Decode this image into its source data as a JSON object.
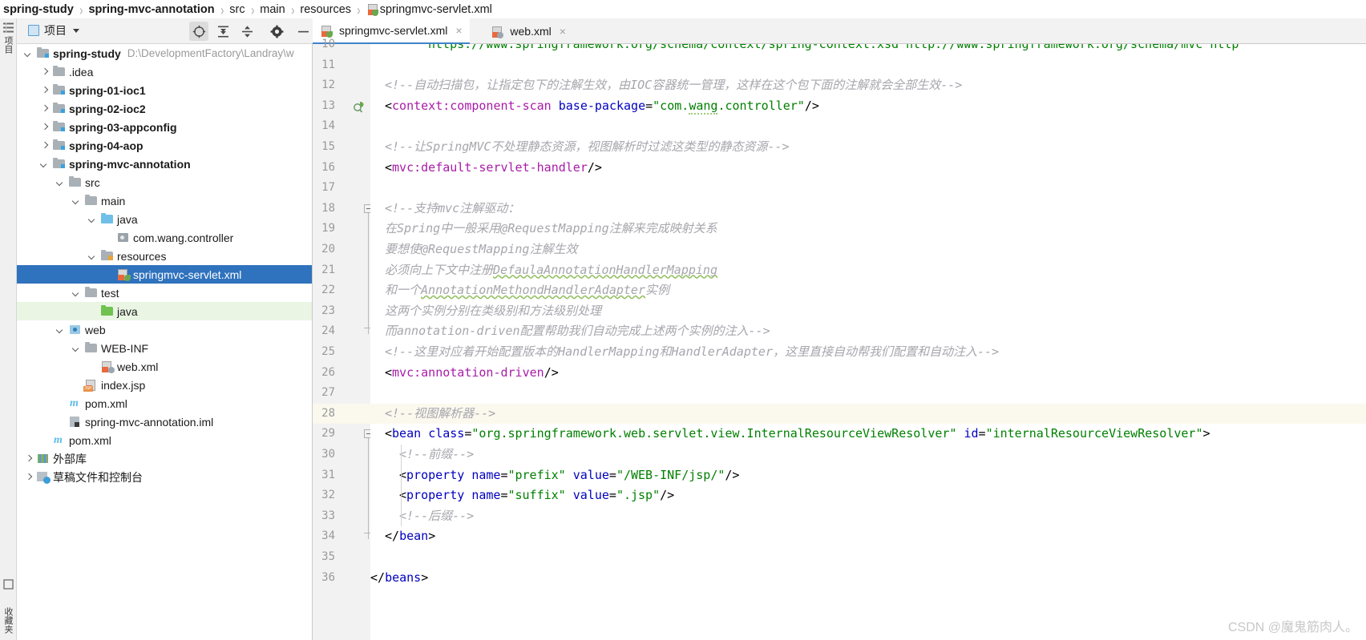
{
  "breadcrumb": {
    "items": [
      {
        "label": "spring-study",
        "bold": true,
        "icon": ""
      },
      {
        "label": "spring-mvc-annotation",
        "bold": true,
        "icon": ""
      },
      {
        "label": "src",
        "bold": false,
        "icon": ""
      },
      {
        "label": "main",
        "bold": false,
        "icon": ""
      },
      {
        "label": "resources",
        "bold": false,
        "icon": ""
      },
      {
        "label": "springmvc-servlet.xml",
        "bold": false,
        "icon": "xml-spring-file-icon"
      }
    ],
    "separator": "›"
  },
  "left_strip": {
    "top_icon": "structure-icon",
    "vertical_label_top": "项目",
    "vertical_label_bottom": "收藏夹"
  },
  "toolbar": {
    "panel_label": "项目",
    "dropdown_caret": "▾",
    "buttons": [
      {
        "name": "locate-in-tree-icon",
        "glyph": "⊕"
      },
      {
        "name": "expand-all-icon",
        "glyph": "⤓"
      },
      {
        "name": "collapse-all-icon",
        "glyph": "⤒"
      },
      {
        "name": "settings-gear-icon",
        "glyph": "⚙"
      },
      {
        "name": "hide-panel-icon",
        "glyph": "−"
      }
    ]
  },
  "tabs": [
    {
      "label": "springmvc-servlet.xml",
      "active": true,
      "icon": "xml-spring-file-icon",
      "close": "×"
    },
    {
      "label": "web.xml",
      "active": false,
      "icon": "xml-web-file-icon",
      "close": "×"
    }
  ],
  "tree": [
    {
      "indent": 0,
      "arrow": "open",
      "icon": "module-folder-icon",
      "label": "spring-study",
      "bold": true,
      "path": "D:\\DevelopmentFactory\\Landray\\w",
      "state": "normal"
    },
    {
      "indent": 1,
      "arrow": "closed",
      "icon": "folder-icon",
      "label": ".idea",
      "bold": false,
      "path": "",
      "state": "normal"
    },
    {
      "indent": 1,
      "arrow": "closed",
      "icon": "module-folder-icon",
      "label": "spring-01-ioc1",
      "bold": true,
      "path": "",
      "state": "normal"
    },
    {
      "indent": 1,
      "arrow": "closed",
      "icon": "module-folder-icon",
      "label": "spring-02-ioc2",
      "bold": true,
      "path": "",
      "state": "normal"
    },
    {
      "indent": 1,
      "arrow": "closed",
      "icon": "module-folder-icon",
      "label": "spring-03-appconfig",
      "bold": true,
      "path": "",
      "state": "normal"
    },
    {
      "indent": 1,
      "arrow": "closed",
      "icon": "module-folder-icon",
      "label": "spring-04-aop",
      "bold": true,
      "path": "",
      "state": "normal"
    },
    {
      "indent": 1,
      "arrow": "open",
      "icon": "module-folder-icon",
      "label": "spring-mvc-annotation",
      "bold": true,
      "path": "",
      "state": "normal"
    },
    {
      "indent": 2,
      "arrow": "open",
      "icon": "folder-icon",
      "label": "src",
      "bold": false,
      "path": "",
      "state": "normal"
    },
    {
      "indent": 3,
      "arrow": "open",
      "icon": "folder-icon",
      "label": "main",
      "bold": false,
      "path": "",
      "state": "normal"
    },
    {
      "indent": 4,
      "arrow": "open",
      "icon": "source-folder-icon",
      "label": "java",
      "bold": false,
      "path": "",
      "state": "normal"
    },
    {
      "indent": 5,
      "arrow": "none",
      "icon": "package-icon",
      "label": "com.wang.controller",
      "bold": false,
      "path": "",
      "state": "normal"
    },
    {
      "indent": 4,
      "arrow": "open",
      "icon": "resources-folder-icon",
      "label": "resources",
      "bold": false,
      "path": "",
      "state": "normal"
    },
    {
      "indent": 5,
      "arrow": "none",
      "icon": "xml-spring-file-icon",
      "label": "springmvc-servlet.xml",
      "bold": false,
      "path": "",
      "state": "selected"
    },
    {
      "indent": 3,
      "arrow": "open",
      "icon": "folder-icon",
      "label": "test",
      "bold": false,
      "path": "",
      "state": "normal"
    },
    {
      "indent": 4,
      "arrow": "none",
      "icon": "test-source-folder-icon",
      "label": "java",
      "bold": false,
      "path": "",
      "state": "green"
    },
    {
      "indent": 2,
      "arrow": "open",
      "icon": "web-folder-icon",
      "label": "web",
      "bold": false,
      "path": "",
      "state": "normal"
    },
    {
      "indent": 3,
      "arrow": "open",
      "icon": "folder-icon",
      "label": "WEB-INF",
      "bold": false,
      "path": "",
      "state": "normal"
    },
    {
      "indent": 4,
      "arrow": "none",
      "icon": "xml-web-file-icon",
      "label": "web.xml",
      "bold": false,
      "path": "",
      "state": "normal"
    },
    {
      "indent": 3,
      "arrow": "none",
      "icon": "jsp-file-icon",
      "label": "index.jsp",
      "bold": false,
      "path": "",
      "state": "normal"
    },
    {
      "indent": 2,
      "arrow": "none",
      "icon": "maven-pom-icon",
      "label": "pom.xml",
      "bold": false,
      "path": "",
      "state": "normal"
    },
    {
      "indent": 2,
      "arrow": "none",
      "icon": "iml-module-icon",
      "label": "spring-mvc-annotation.iml",
      "bold": false,
      "path": "",
      "state": "normal"
    },
    {
      "indent": 1,
      "arrow": "none",
      "icon": "maven-pom-icon",
      "label": "pom.xml",
      "bold": false,
      "path": "",
      "state": "normal"
    },
    {
      "indent": 0,
      "arrow": "closed",
      "icon": "external-libraries-icon",
      "label": "外部库",
      "bold": false,
      "path": "",
      "state": "normal"
    },
    {
      "indent": 0,
      "arrow": "closed",
      "icon": "scratches-icon",
      "label": "草稿文件和控制台",
      "bold": false,
      "path": "",
      "state": "normal"
    }
  ],
  "editor": {
    "first_visible_line": 10,
    "highlighted_line": 28,
    "gutter_marker_line": 13,
    "gutter_marker_icon": "spring-bean-gutter-icon",
    "lines": [
      {
        "n": 10,
        "indent": 4,
        "clipped_top": true,
        "segments": [
          {
            "t": "url",
            "s": "https://www.springframework.org/schema/context/spring-context.xsd http://www.springframework.org/schema/mvc http"
          }
        ]
      },
      {
        "n": 11,
        "indent": 0,
        "segments": []
      },
      {
        "n": 12,
        "indent": 1,
        "segments": [
          {
            "t": "cmt",
            "s": "<!--自动扫描包，让指定包下的注解生效，由IOC容器统一管理，这样在这个包下面的注解就会全部生效-->"
          }
        ]
      },
      {
        "n": 13,
        "indent": 1,
        "segments": [
          {
            "t": "punc",
            "s": "<"
          },
          {
            "t": "ns",
            "s": "context:component-scan"
          },
          {
            "t": "plain",
            "s": " "
          },
          {
            "t": "attr",
            "s": "base-package"
          },
          {
            "t": "punc",
            "s": "="
          },
          {
            "t": "val",
            "s": "\"com."
          },
          {
            "t": "val-sq",
            "s": "wang"
          },
          {
            "t": "val",
            "s": ".controller\""
          },
          {
            "t": "punc",
            "s": "/>"
          }
        ]
      },
      {
        "n": 14,
        "indent": 0,
        "segments": []
      },
      {
        "n": 15,
        "indent": 1,
        "segments": [
          {
            "t": "cmt",
            "s": "<!--让SpringMVC不处理静态资源，视图解析时过滤这类型的静态资源-->"
          }
        ]
      },
      {
        "n": 16,
        "indent": 1,
        "segments": [
          {
            "t": "punc",
            "s": "<"
          },
          {
            "t": "ns",
            "s": "mvc:default-servlet-handler"
          },
          {
            "t": "punc",
            "s": "/>"
          }
        ]
      },
      {
        "n": 17,
        "indent": 0,
        "segments": []
      },
      {
        "n": 18,
        "indent": 1,
        "fold": "start",
        "segments": [
          {
            "t": "cmt",
            "s": "<!--支持mvc注解驱动："
          }
        ]
      },
      {
        "n": 19,
        "indent": 1,
        "segments": [
          {
            "t": "cmt",
            "s": "在Spring中一般采用@RequestMapping注解来完成映射关系"
          }
        ]
      },
      {
        "n": 20,
        "indent": 1,
        "segments": [
          {
            "t": "cmt",
            "s": "要想使@RequestMapping注解生效"
          }
        ]
      },
      {
        "n": 21,
        "indent": 1,
        "segments": [
          {
            "t": "cmt",
            "s": "必须向上下文中注册"
          },
          {
            "t": "cmt-sq",
            "s": "DefaulaAnnotationHandlerMapping"
          }
        ]
      },
      {
        "n": 22,
        "indent": 1,
        "segments": [
          {
            "t": "cmt",
            "s": "和一个"
          },
          {
            "t": "cmt-sq",
            "s": "AnnotationMethondHandlerAdapter"
          },
          {
            "t": "cmt",
            "s": "实例"
          }
        ]
      },
      {
        "n": 23,
        "indent": 1,
        "segments": [
          {
            "t": "cmt",
            "s": "这两个实例分别在类级别和方法级别处理"
          }
        ]
      },
      {
        "n": 24,
        "indent": 1,
        "fold": "end",
        "segments": [
          {
            "t": "cmt",
            "s": "而annotation-driven配置帮助我们自动完成上述两个实例的注入-->"
          }
        ]
      },
      {
        "n": 25,
        "indent": 1,
        "segments": [
          {
            "t": "cmt",
            "s": "<!--这里对应着开始配置版本的HandlerMapping和HandlerAdapter，这里直接自动帮我们配置和自动注入-->"
          }
        ]
      },
      {
        "n": 26,
        "indent": 1,
        "segments": [
          {
            "t": "punc",
            "s": "<"
          },
          {
            "t": "ns",
            "s": "mvc:annotation-driven"
          },
          {
            "t": "punc",
            "s": "/>"
          }
        ]
      },
      {
        "n": 27,
        "indent": 0,
        "segments": []
      },
      {
        "n": 28,
        "indent": 1,
        "highlight": true,
        "segments": [
          {
            "t": "cmt",
            "s": "<!--视图解析器-->"
          }
        ]
      },
      {
        "n": 29,
        "indent": 1,
        "fold": "start",
        "segments": [
          {
            "t": "punc",
            "s": "<"
          },
          {
            "t": "tag",
            "s": "bean"
          },
          {
            "t": "plain",
            "s": " "
          },
          {
            "t": "attr",
            "s": "class"
          },
          {
            "t": "punc",
            "s": "="
          },
          {
            "t": "val",
            "s": "\"org.springframework.web.servlet.view.InternalResourceViewResolver\""
          },
          {
            "t": "plain",
            "s": " "
          },
          {
            "t": "attr",
            "s": "id"
          },
          {
            "t": "punc",
            "s": "="
          },
          {
            "t": "val",
            "s": "\"internalResourceViewResolver\""
          },
          {
            "t": "punc",
            "s": ">"
          }
        ]
      },
      {
        "n": 30,
        "indent": 2,
        "segments": [
          {
            "t": "cmt",
            "s": "<!--前缀-->"
          }
        ]
      },
      {
        "n": 31,
        "indent": 2,
        "segments": [
          {
            "t": "punc",
            "s": "<"
          },
          {
            "t": "tag",
            "s": "property"
          },
          {
            "t": "plain",
            "s": " "
          },
          {
            "t": "attr",
            "s": "name"
          },
          {
            "t": "punc",
            "s": "="
          },
          {
            "t": "val",
            "s": "\"prefix\""
          },
          {
            "t": "plain",
            "s": " "
          },
          {
            "t": "attr",
            "s": "value"
          },
          {
            "t": "punc",
            "s": "="
          },
          {
            "t": "val",
            "s": "\"/WEB-INF/jsp/\""
          },
          {
            "t": "punc",
            "s": "/>"
          }
        ]
      },
      {
        "n": 32,
        "indent": 2,
        "segments": [
          {
            "t": "punc",
            "s": "<"
          },
          {
            "t": "tag",
            "s": "property"
          },
          {
            "t": "plain",
            "s": " "
          },
          {
            "t": "attr",
            "s": "name"
          },
          {
            "t": "punc",
            "s": "="
          },
          {
            "t": "val",
            "s": "\"suffix\""
          },
          {
            "t": "plain",
            "s": " "
          },
          {
            "t": "attr",
            "s": "value"
          },
          {
            "t": "punc",
            "s": "="
          },
          {
            "t": "val",
            "s": "\".jsp\""
          },
          {
            "t": "punc",
            "s": "/>"
          }
        ]
      },
      {
        "n": 33,
        "indent": 2,
        "segments": [
          {
            "t": "cmt",
            "s": "<!--后缀-->"
          }
        ]
      },
      {
        "n": 34,
        "indent": 1,
        "fold": "end",
        "segments": [
          {
            "t": "punc",
            "s": "</"
          },
          {
            "t": "tag",
            "s": "bean"
          },
          {
            "t": "punc",
            "s": ">"
          }
        ]
      },
      {
        "n": 35,
        "indent": 0,
        "segments": []
      },
      {
        "n": 36,
        "indent": 0,
        "segments": [
          {
            "t": "punc",
            "s": "</"
          },
          {
            "t": "tag",
            "s": "beans"
          },
          {
            "t": "punc",
            "s": ">"
          }
        ]
      }
    ]
  },
  "watermark": {
    "text": "CSDN @魔鬼筋肉人。"
  },
  "colors": {
    "tag": "#0000c0",
    "namespace": "#a81ba8",
    "attribute": "#0000c0",
    "value": "#008000",
    "comment": "#a6a6ad",
    "selection": "#2f72bd",
    "green_row": "#eaf5e4",
    "line_highlight": "#fbf8ee",
    "gutter_bg": "#f2f2f2",
    "line_number": "#9a9a9a"
  }
}
